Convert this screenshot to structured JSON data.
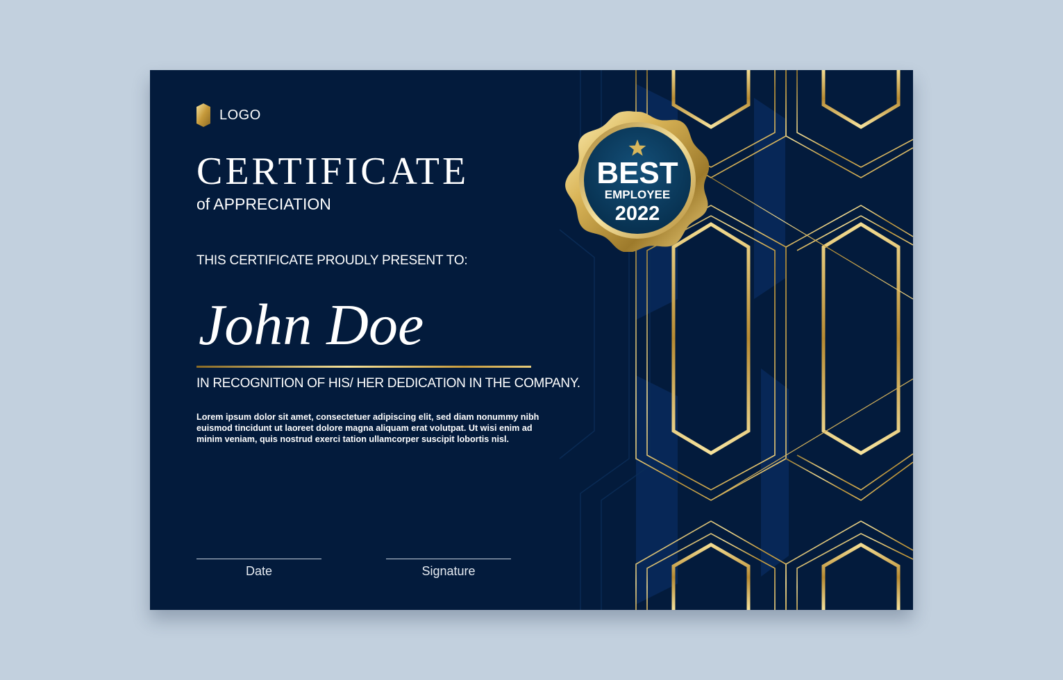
{
  "logo": {
    "text": "LOGO",
    "icon": "gold-hexagon-icon"
  },
  "title": "CERTIFICATE",
  "subtitle": "of APPRECIATION",
  "presented_to_label": "THIS CERTIFICATE PROUDLY PRESENT TO:",
  "recipient_name": "John Doe",
  "recognition_text": "IN RECOGNITION OF HIS/ HER DEDICATION IN THE COMPANY.",
  "body_lines": [
    "Lorem ipsum dolor sit amet, consectetuer adipiscing elit, sed diam nonummy nibh",
    "euismod tincidunt ut laoreet dolore magna aliquam erat volutpat. Ut wisi enim ad",
    "minim veniam, quis nostrud exerci tation ullamcorper suscipit lobortis nisl."
  ],
  "signatures": {
    "date_label": "Date",
    "signature_label": "Signature"
  },
  "badge": {
    "line1": "BEST",
    "line2": "EMPLOYEE",
    "line3": "2022",
    "icon": "star-icon"
  },
  "colors": {
    "background": "#c2d0de",
    "certificate": "#031b3c",
    "gold": "#d4b15a",
    "badge_blue": "#0b3f63",
    "text": "#ffffff"
  }
}
